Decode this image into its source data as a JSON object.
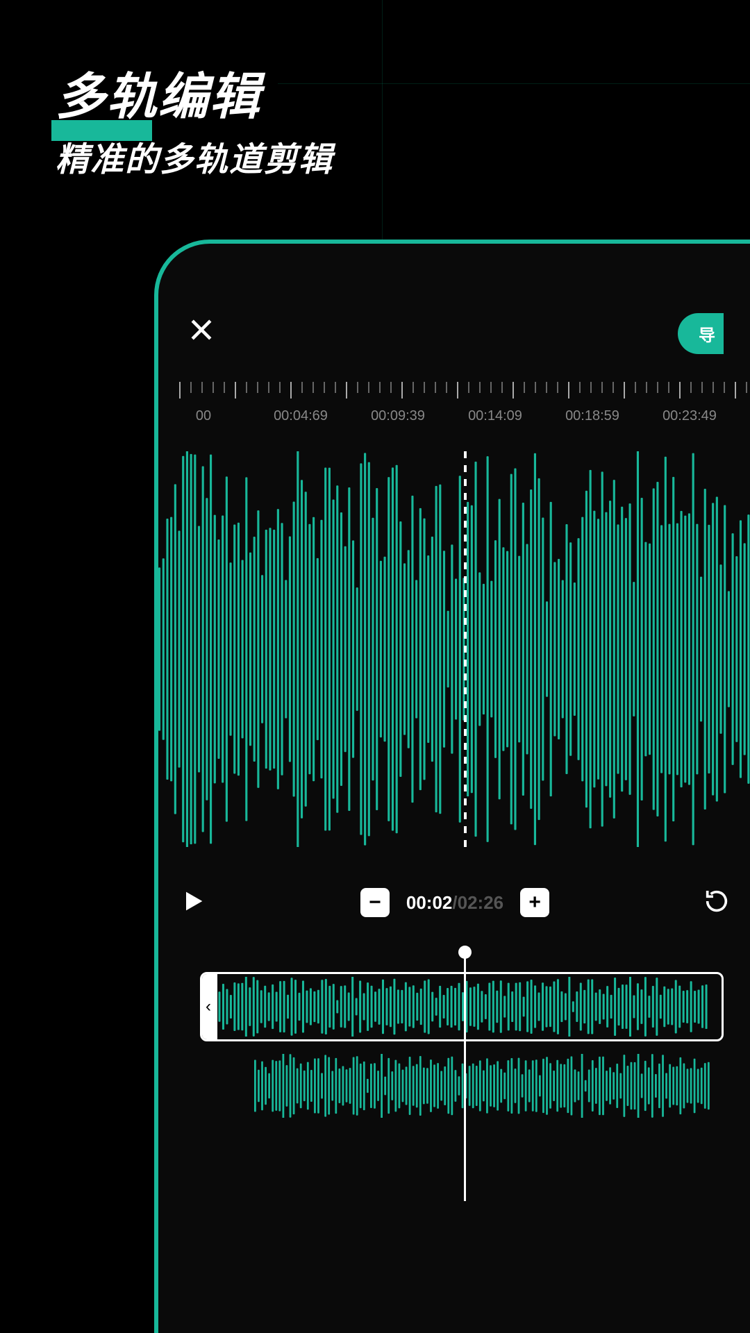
{
  "promo": {
    "title": "多轨编辑",
    "subtitle": "精准的多轨道剪辑"
  },
  "editor": {
    "export_label": "导",
    "ruler_times": [
      "00",
      "00:04:69",
      "00:09:39",
      "00:14:09",
      "00:18:59",
      "00:23:49"
    ],
    "ruler_tick_count": 60,
    "playback": {
      "current_time": "00:02",
      "total_time": "02:26",
      "separator": "/"
    },
    "zoom": {
      "minus_label": "−",
      "plus_label": "+"
    },
    "clip_handle_label": "‹",
    "accent_color": "#18b89a"
  }
}
